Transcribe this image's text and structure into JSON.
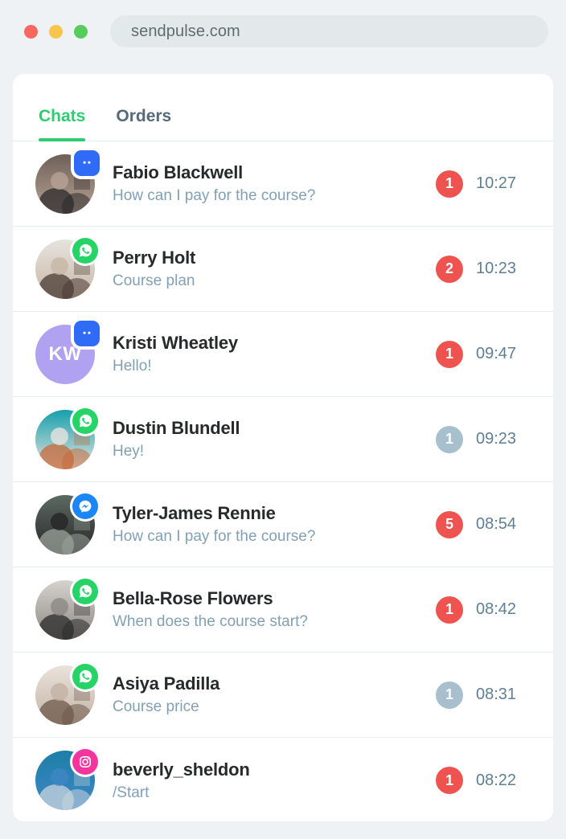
{
  "browser": {
    "url": "sendpulse.com",
    "traffic_lights": [
      {
        "name": "close-button",
        "color": "#f9685f"
      },
      {
        "name": "minimize-button",
        "color": "#f8c64e"
      },
      {
        "name": "maximize-button",
        "color": "#55cc5c"
      }
    ]
  },
  "colors": {
    "page_background": "#eef2f4",
    "card_background": "#ffffff",
    "accent_green": "#2ecc71",
    "unread_active": "#ef5350",
    "unread_muted": "#a8bfce",
    "name_text": "#27292b",
    "preview_text": "#82a0b4",
    "time_text": "#5f7f94",
    "divider": "#e6ecee",
    "whatsapp": "#25d366",
    "messenger": "#1b87f7",
    "instagram": "#f5359e",
    "livechat": "#2f6bf6"
  },
  "tabs": [
    {
      "label": "Chats",
      "active": true
    },
    {
      "label": "Orders",
      "active": false
    }
  ],
  "chats": [
    {
      "name": "Fabio Blackwell",
      "preview": "How can I pay for the course?",
      "time": "10:27",
      "unread": "1",
      "unread_state": "active",
      "channel": "livechat",
      "avatar_type": "photo",
      "avatar_style": "street-crowd",
      "avatar_colors": [
        "#6e6058",
        "#b8a395",
        "#2c2a2c"
      ]
    },
    {
      "name": "Perry Holt",
      "preview": "Course plan",
      "time": "10:23",
      "unread": "2",
      "unread_state": "active",
      "channel": "whatsapp",
      "avatar_type": "photo",
      "avatar_style": "woman-beret",
      "avatar_colors": [
        "#e6e3dd",
        "#c8b6a6",
        "#4a3b34"
      ]
    },
    {
      "name": "Kristi Wheatley",
      "preview": "Hello!",
      "time": "09:47",
      "unread": "1",
      "unread_state": "active",
      "channel": "livechat",
      "avatar_type": "initials",
      "avatar_initials": "KW",
      "avatar_colors": [
        "#b0a2f0"
      ]
    },
    {
      "name": "Dustin Blundell",
      "preview": "Hey!",
      "time": "09:23",
      "unread": "1",
      "unread_state": "muted",
      "channel": "whatsapp",
      "avatar_type": "photo",
      "avatar_style": "teal-skateboard",
      "avatar_colors": [
        "#17a0ad",
        "#e8e4de",
        "#c76a3a"
      ]
    },
    {
      "name": "Tyler-James Rennie",
      "preview": "How can I pay for the course?",
      "time": "08:54",
      "unread": "5",
      "unread_state": "active",
      "channel": "messenger",
      "avatar_type": "photo",
      "avatar_style": "dark-coat",
      "avatar_colors": [
        "#5c6a63",
        "#262627",
        "#9aa39a"
      ]
    },
    {
      "name": "Bella-Rose Flowers",
      "preview": "When does the course start?",
      "time": "08:42",
      "unread": "1",
      "unread_state": "active",
      "channel": "whatsapp",
      "avatar_type": "photo",
      "avatar_style": "bw-two-women",
      "avatar_colors": [
        "#d6d2cd",
        "#8c8884",
        "#2b2b2b"
      ]
    },
    {
      "name": "Asiya Padilla",
      "preview": "Course price",
      "time": "08:31",
      "unread": "1",
      "unread_state": "muted",
      "channel": "whatsapp",
      "avatar_type": "photo",
      "avatar_style": "white-outfit-wall",
      "avatar_colors": [
        "#e9e3dc",
        "#c3b2a4",
        "#6e5a4c"
      ]
    },
    {
      "name": "beverly_sheldon",
      "preview": "/Start",
      "time": "08:22",
      "unread": "1",
      "unread_state": "active",
      "channel": "instagram",
      "avatar_type": "photo",
      "avatar_style": "denim-hoodie-blue",
      "avatar_colors": [
        "#1d7fa8",
        "#3f87c4",
        "#c9d4dc"
      ]
    }
  ],
  "icons": {
    "livechat": "livechat-bubble-icon",
    "whatsapp": "whatsapp-icon",
    "messenger": "messenger-icon",
    "instagram": "instagram-icon"
  }
}
